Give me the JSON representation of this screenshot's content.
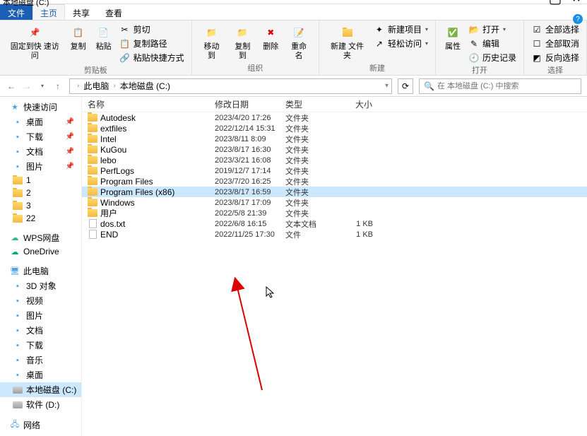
{
  "window": {
    "title": "本地磁盘 (C:)"
  },
  "tabs": {
    "file": "文件",
    "home": "主页",
    "share": "共享",
    "view": "查看"
  },
  "ribbon": {
    "clipboard": {
      "pin": "固定到快\n速访问",
      "copy": "复制",
      "paste": "粘贴",
      "cut": "剪切",
      "copy_path": "复制路径",
      "paste_shortcut": "粘贴快捷方式",
      "label": "剪贴板"
    },
    "organize": {
      "move": "移动到",
      "copyto": "复制到",
      "delete": "删除",
      "rename": "重命名",
      "label": "组织"
    },
    "new": {
      "newfolder": "新建\n文件夹",
      "newitem": "新建项目",
      "easy": "轻松访问",
      "label": "新建"
    },
    "open": {
      "props": "属性",
      "open": "打开",
      "edit": "编辑",
      "history": "历史记录",
      "label": "打开"
    },
    "select": {
      "all": "全部选择",
      "none": "全部取消",
      "invert": "反向选择",
      "label": "选择"
    }
  },
  "addr": {
    "computer": "此电脑",
    "drive": "本地磁盘 (C:)"
  },
  "search": {
    "placeholder": "在 本地磁盘 (C:) 中搜索"
  },
  "sidebar": {
    "quick": "快速访问",
    "pins": [
      {
        "label": "桌面",
        "icon": "desktop"
      },
      {
        "label": "下载",
        "icon": "download"
      },
      {
        "label": "文档",
        "icon": "doc"
      },
      {
        "label": "图片",
        "icon": "pic"
      }
    ],
    "folders": [
      "1",
      "2",
      "3",
      "22"
    ],
    "wps": "WPS网盘",
    "onedrive": "OneDrive",
    "pc": "此电脑",
    "pc_items": [
      "3D 对象",
      "视频",
      "图片",
      "文档",
      "下载",
      "音乐",
      "桌面",
      "本地磁盘 (C:)",
      "软件 (D:)"
    ],
    "network": "网络"
  },
  "cols": {
    "name": "名称",
    "date": "修改日期",
    "type": "类型",
    "size": "大小"
  },
  "files": [
    {
      "name": "Autodesk",
      "date": "2023/4/20 17:26",
      "type": "文件夹",
      "size": "",
      "icon": "folder"
    },
    {
      "name": "extfiles",
      "date": "2022/12/14 15:31",
      "type": "文件夹",
      "size": "",
      "icon": "folder"
    },
    {
      "name": "Intel",
      "date": "2023/8/11 8:09",
      "type": "文件夹",
      "size": "",
      "icon": "folder"
    },
    {
      "name": "KuGou",
      "date": "2023/8/17 16:30",
      "type": "文件夹",
      "size": "",
      "icon": "folder"
    },
    {
      "name": "lebo",
      "date": "2023/3/21 16:08",
      "type": "文件夹",
      "size": "",
      "icon": "folder"
    },
    {
      "name": "PerfLogs",
      "date": "2019/12/7 17:14",
      "type": "文件夹",
      "size": "",
      "icon": "folder"
    },
    {
      "name": "Program Files",
      "date": "2023/7/20 16:25",
      "type": "文件夹",
      "size": "",
      "icon": "folder"
    },
    {
      "name": "Program Files (x86)",
      "date": "2023/8/17 16:59",
      "type": "文件夹",
      "size": "",
      "icon": "folder",
      "selected": true
    },
    {
      "name": "Windows",
      "date": "2023/8/17 17:09",
      "type": "文件夹",
      "size": "",
      "icon": "folder"
    },
    {
      "name": "用户",
      "date": "2022/5/8 21:39",
      "type": "文件夹",
      "size": "",
      "icon": "folder"
    },
    {
      "name": "dos.txt",
      "date": "2022/6/8 16:15",
      "type": "文本文档",
      "size": "1 KB",
      "icon": "file"
    },
    {
      "name": "END",
      "date": "2022/11/25 17:30",
      "type": "文件",
      "size": "1 KB",
      "icon": "file"
    }
  ]
}
